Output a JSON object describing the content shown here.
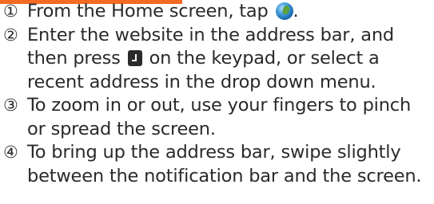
{
  "icons": {
    "browser": "browser-globe-icon",
    "enter": "enter-key-icon"
  },
  "colors": {
    "accent": "#f36b21",
    "text": "#2a2a2a"
  },
  "steps": [
    {
      "marker": "①",
      "before_icon": "From the Home screen, tap ",
      "after_icon": "."
    },
    {
      "marker": "②",
      "before_icon": "Enter the website in the address bar, and then press ",
      "after_icon": " on the keypad, or select a recent address in the drop down menu."
    },
    {
      "marker": "③",
      "text": "To zoom in or out, use your fingers to pinch or spread the screen."
    },
    {
      "marker": "④",
      "text": "To bring up the address bar, swipe slightly between the notification bar and the screen."
    }
  ]
}
